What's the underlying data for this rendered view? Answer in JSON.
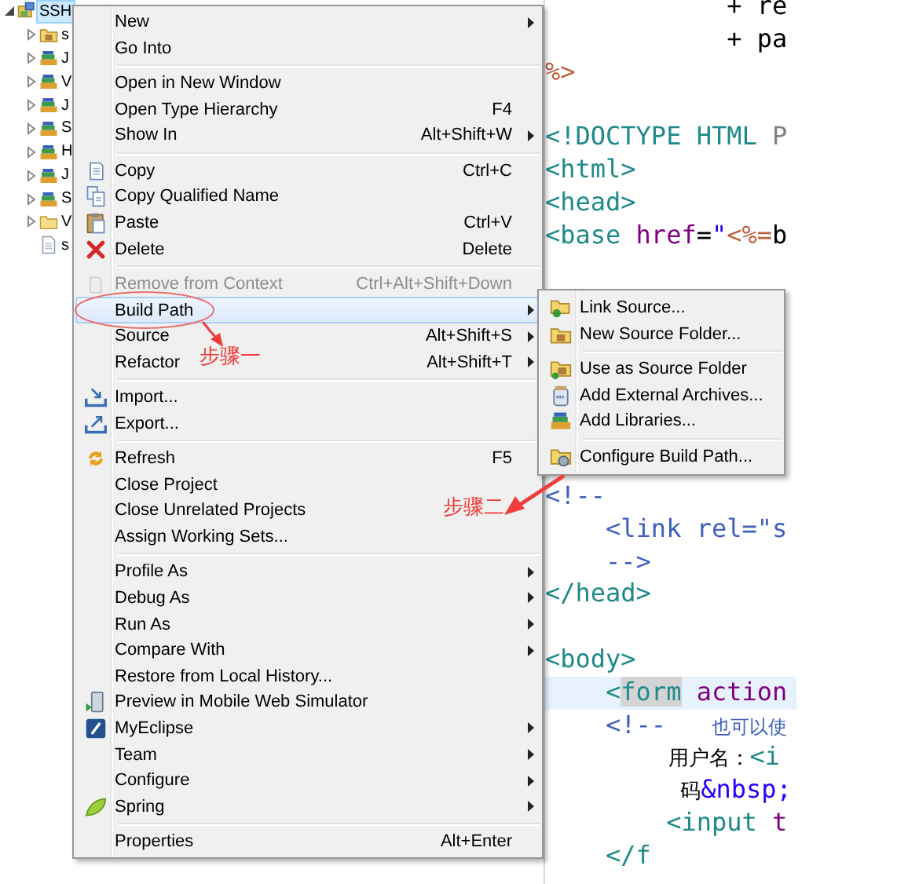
{
  "project_explorer": {
    "items": [
      {
        "label": "SSH",
        "kind": "project",
        "expanded": true,
        "selected": true,
        "children": [
          {
            "label": "s",
            "kind": "source-folder",
            "expanded": false,
            "selected": false
          },
          {
            "label": "J",
            "kind": "library",
            "expanded": false,
            "selected": false
          },
          {
            "label": "V",
            "kind": "library",
            "expanded": false,
            "selected": false
          },
          {
            "label": "J",
            "kind": "library",
            "expanded": false,
            "selected": false
          },
          {
            "label": "S",
            "kind": "library",
            "expanded": false,
            "selected": false
          },
          {
            "label": "H",
            "kind": "library",
            "expanded": false,
            "selected": false
          },
          {
            "label": "J",
            "kind": "library",
            "expanded": false,
            "selected": false
          },
          {
            "label": "S",
            "kind": "library",
            "expanded": false,
            "selected": false
          },
          {
            "label": "V",
            "kind": "folder",
            "expanded": false,
            "selected": false
          },
          {
            "label": "s",
            "kind": "file",
            "selected": false
          }
        ]
      }
    ]
  },
  "editor": {
    "lines": [
      {
        "kind": "code",
        "current": false,
        "tokens": [
          {
            "kind": "plain",
            "text": "            + re"
          }
        ]
      },
      {
        "kind": "code",
        "current": false,
        "tokens": [
          {
            "kind": "plain",
            "text": "            + pa"
          }
        ]
      },
      {
        "kind": "code",
        "current": false,
        "tokens": [
          {
            "kind": "jsp",
            "text": "%>"
          }
        ]
      },
      {
        "kind": "blank"
      },
      {
        "kind": "code",
        "current": false,
        "tokens": [
          {
            "kind": "tag",
            "text": "<!DOCTYPE HTML "
          },
          {
            "kind": "doctype-id",
            "text": "P"
          }
        ]
      },
      {
        "kind": "code",
        "current": false,
        "tokens": [
          {
            "kind": "tag",
            "text": "<html>"
          }
        ]
      },
      {
        "kind": "code",
        "current": false,
        "tokens": [
          {
            "kind": "tag",
            "text": "<head>"
          }
        ]
      },
      {
        "kind": "code",
        "current": false,
        "tokens": [
          {
            "kind": "tag",
            "text": "<base "
          },
          {
            "kind": "attr",
            "text": "href"
          },
          {
            "kind": "plain",
            "text": "="
          },
          {
            "kind": "str",
            "text": "\""
          },
          {
            "kind": "jsp",
            "text": "<%="
          },
          {
            "kind": "plain",
            "text": "b"
          }
        ]
      },
      {
        "kind": "blank"
      },
      {
        "kind": "blank"
      },
      {
        "kind": "blank"
      },
      {
        "kind": "blank"
      },
      {
        "kind": "blank"
      },
      {
        "kind": "blank"
      },
      {
        "kind": "blank"
      },
      {
        "kind": "code",
        "current": false,
        "tokens": [
          {
            "kind": "comment",
            "text": "<!--"
          }
        ]
      },
      {
        "kind": "code",
        "current": false,
        "tokens": [
          {
            "kind": "comment",
            "text": "    <link rel=\"s"
          }
        ]
      },
      {
        "kind": "code",
        "current": false,
        "tokens": [
          {
            "kind": "comment",
            "text": "    -->"
          }
        ]
      },
      {
        "kind": "code",
        "current": false,
        "tokens": [
          {
            "kind": "tag",
            "text": "</head>"
          }
        ]
      },
      {
        "kind": "blank"
      },
      {
        "kind": "code",
        "current": false,
        "tokens": [
          {
            "kind": "tag",
            "text": "<body>"
          }
        ]
      },
      {
        "kind": "code",
        "current": true,
        "tokens": [
          {
            "kind": "tag",
            "text": "    <"
          },
          {
            "kind": "marked-tag",
            "text": "form"
          },
          {
            "kind": "attr",
            "text": " action"
          }
        ]
      },
      {
        "kind": "code",
        "current": false,
        "tokens": [
          {
            "kind": "comment",
            "text": "    <!--   "
          },
          {
            "kind": "comment-cjk",
            "text": "也可以使"
          }
        ]
      },
      {
        "kind": "code",
        "current": false,
        "tokens": [
          {
            "kind": "text-cjk",
            "text": "          用户名："
          },
          {
            "kind": "tag",
            "text": "<i"
          }
        ]
      },
      {
        "kind": "code",
        "current": false,
        "tokens": [
          {
            "kind": "text-cjk",
            "text": "           码"
          },
          {
            "kind": "entity",
            "text": "&nbsp;"
          }
        ]
      },
      {
        "kind": "code",
        "current": false,
        "tokens": [
          {
            "kind": "tag",
            "text": "        <input"
          },
          {
            "kind": "attr",
            "text": " t"
          }
        ]
      },
      {
        "kind": "code",
        "current": false,
        "tokens": [
          {
            "kind": "tag",
            "text": "    </f"
          }
        ]
      }
    ]
  },
  "context_menu": {
    "items": [
      {
        "kind": "item",
        "label": "New",
        "submenu": true,
        "disabled": false,
        "selected": false
      },
      {
        "kind": "item",
        "label": "Go Into",
        "disabled": false,
        "selected": false
      },
      {
        "kind": "separator"
      },
      {
        "kind": "item",
        "label": "Open in New Window",
        "disabled": false,
        "selected": false
      },
      {
        "kind": "item",
        "label": "Open Type Hierarchy",
        "shortcut": "F4",
        "disabled": false,
        "selected": false
      },
      {
        "kind": "item",
        "label": "Show In",
        "shortcut": "Alt+Shift+W",
        "submenu": true,
        "disabled": false,
        "selected": false
      },
      {
        "kind": "separator"
      },
      {
        "kind": "item",
        "label": "Copy",
        "shortcut": "Ctrl+C",
        "disabled": false,
        "selected": false
      },
      {
        "kind": "item",
        "label": "Copy Qualified Name",
        "disabled": false,
        "selected": false
      },
      {
        "kind": "item",
        "label": "Paste",
        "shortcut": "Ctrl+V",
        "disabled": false,
        "selected": false
      },
      {
        "kind": "item",
        "label": "Delete",
        "shortcut": "Delete",
        "disabled": false,
        "selected": false
      },
      {
        "kind": "separator"
      },
      {
        "kind": "item",
        "label": "Remove from Context",
        "shortcut": "Ctrl+Alt+Shift+Down",
        "disabled": true,
        "selected": false
      },
      {
        "kind": "item",
        "label": "Build Path",
        "submenu": true,
        "disabled": false,
        "selected": true
      },
      {
        "kind": "item",
        "label": "Source",
        "shortcut": "Alt+Shift+S",
        "submenu": true,
        "disabled": false,
        "selected": false
      },
      {
        "kind": "item",
        "label": "Refactor",
        "shortcut": "Alt+Shift+T",
        "submenu": true,
        "disabled": false,
        "selected": false
      },
      {
        "kind": "separator"
      },
      {
        "kind": "item",
        "label": "Import...",
        "disabled": false,
        "selected": false
      },
      {
        "kind": "item",
        "label": "Export...",
        "disabled": false,
        "selected": false
      },
      {
        "kind": "separator"
      },
      {
        "kind": "item",
        "label": "Refresh",
        "shortcut": "F5",
        "disabled": false,
        "selected": false
      },
      {
        "kind": "item",
        "label": "Close Project",
        "disabled": false,
        "selected": false
      },
      {
        "kind": "item",
        "label": "Close Unrelated Projects",
        "disabled": false,
        "selected": false
      },
      {
        "kind": "item",
        "label": "Assign Working Sets...",
        "disabled": false,
        "selected": false
      },
      {
        "kind": "separator"
      },
      {
        "kind": "item",
        "label": "Profile As",
        "submenu": true,
        "disabled": false,
        "selected": false
      },
      {
        "kind": "item",
        "label": "Debug As",
        "submenu": true,
        "disabled": false,
        "selected": false
      },
      {
        "kind": "item",
        "label": "Run As",
        "submenu": true,
        "disabled": false,
        "selected": false
      },
      {
        "kind": "item",
        "label": "Compare With",
        "submenu": true,
        "disabled": false,
        "selected": false
      },
      {
        "kind": "item",
        "label": "Restore from Local History...",
        "disabled": false,
        "selected": false
      },
      {
        "kind": "item",
        "label": "Preview in Mobile Web Simulator",
        "disabled": false,
        "selected": false
      },
      {
        "kind": "item",
        "label": "MyEclipse",
        "submenu": true,
        "disabled": false,
        "selected": false
      },
      {
        "kind": "item",
        "label": "Team",
        "submenu": true,
        "disabled": false,
        "selected": false
      },
      {
        "kind": "item",
        "label": "Configure",
        "submenu": true,
        "disabled": false,
        "selected": false
      },
      {
        "kind": "item",
        "label": "Spring",
        "submenu": true,
        "disabled": false,
        "selected": false
      },
      {
        "kind": "separator"
      },
      {
        "kind": "item",
        "label": "Properties",
        "shortcut": "Alt+Enter",
        "disabled": false,
        "selected": false
      }
    ]
  },
  "build_path_submenu": {
    "items": [
      {
        "kind": "item",
        "label": "Link Source...",
        "disabled": false,
        "selected": false
      },
      {
        "kind": "item",
        "label": "New Source Folder...",
        "disabled": false,
        "selected": false
      },
      {
        "kind": "separator"
      },
      {
        "kind": "item",
        "label": "Use as Source Folder",
        "disabled": false,
        "selected": false
      },
      {
        "kind": "item",
        "label": "Add External Archives...",
        "disabled": false,
        "selected": false
      },
      {
        "kind": "item",
        "label": "Add Libraries...",
        "disabled": false,
        "selected": false
      },
      {
        "kind": "separator"
      },
      {
        "kind": "item",
        "label": "Configure Build Path...",
        "disabled": false,
        "selected": false
      }
    ]
  },
  "annotations": [
    {
      "text": "步骤一"
    },
    {
      "text": "步骤二"
    }
  ]
}
